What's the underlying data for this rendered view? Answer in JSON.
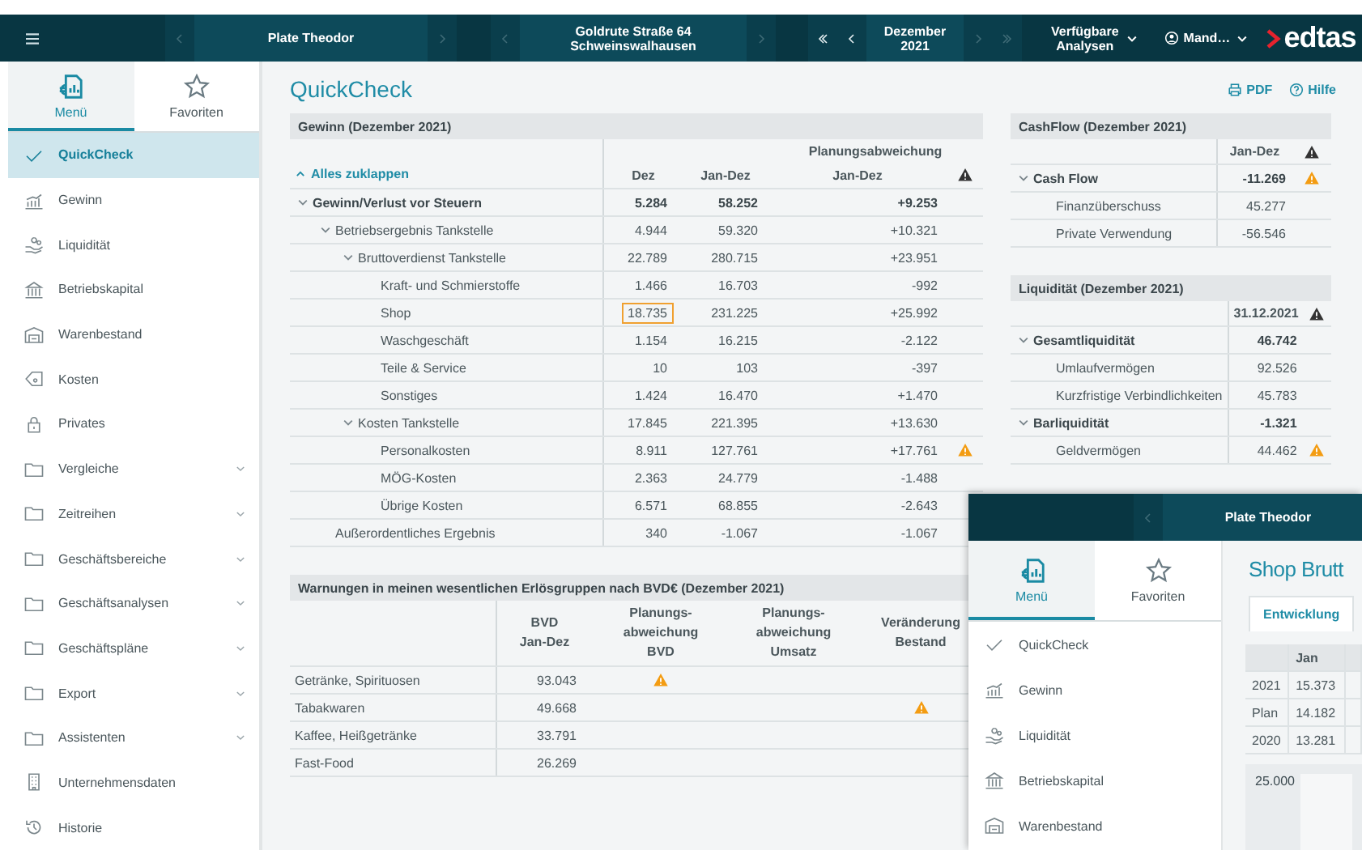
{
  "topbar": {
    "groups": [
      {
        "label": [
          "Plate Theodor"
        ],
        "before": [
          {
            "kind": "prev",
            "disabled": true
          }
        ],
        "after": [
          {
            "kind": "next",
            "disabled": true
          }
        ]
      },
      {
        "label": [
          "Goldrute Straße 64",
          "Schweinswalhausen"
        ],
        "before": [
          {
            "kind": "prev",
            "disabled": true
          }
        ],
        "after": [
          {
            "kind": "next",
            "disabled": true
          }
        ]
      },
      {
        "label": [
          "Dezember",
          "2021"
        ],
        "before": [
          {
            "kind": "first",
            "disabled": false
          },
          {
            "kind": "prev",
            "disabled": false
          }
        ],
        "after": [
          {
            "kind": "next",
            "disabled": true
          },
          {
            "kind": "last",
            "disabled": true
          }
        ]
      }
    ],
    "analyses": [
      "Verfügbare",
      "Analysen"
    ],
    "user": "Mand…",
    "logo": "edtas"
  },
  "menu_tabs": [
    {
      "label": "Menü",
      "selected": true
    },
    {
      "label": "Favoriten",
      "selected": false
    }
  ],
  "sidebar": [
    {
      "label": "QuickCheck",
      "kind": "page",
      "selected": true
    },
    {
      "label": "Gewinn",
      "kind": "page",
      "selected": false
    },
    {
      "label": "Liquidität",
      "kind": "page",
      "selected": false
    },
    {
      "label": "Betriebskapital",
      "kind": "page",
      "selected": false
    },
    {
      "label": "Warenbestand",
      "kind": "page",
      "selected": false
    },
    {
      "label": "Kosten",
      "kind": "page",
      "selected": false
    },
    {
      "label": "Privates",
      "kind": "page",
      "selected": false
    },
    {
      "label": "Vergleiche",
      "kind": "group",
      "selected": false
    },
    {
      "label": "Zeitreihen",
      "kind": "group",
      "selected": false
    },
    {
      "label": "Geschäftsbereiche",
      "kind": "group",
      "selected": false
    },
    {
      "label": "Geschäftsanalysen",
      "kind": "group",
      "selected": false
    },
    {
      "label": "Geschäftspläne",
      "kind": "group",
      "selected": false
    },
    {
      "label": "Export",
      "kind": "group",
      "selected": false
    },
    {
      "label": "Assistenten",
      "kind": "group",
      "selected": false
    },
    {
      "label": "Unternehmensdaten",
      "kind": "page",
      "selected": false
    },
    {
      "label": "Historie",
      "kind": "page",
      "selected": false
    }
  ],
  "title": "QuickCheck",
  "actions": [
    "PDF",
    "Hilfe"
  ],
  "gewinn": {
    "title": "Gewinn (Dezember 2021)",
    "collapse_all": "Alles zuklappen",
    "group_header": "Planungsabweichung",
    "columns": [
      "Dez",
      "Jan-Dez",
      "Jan-Dez"
    ],
    "rows": [
      {
        "label": "Gewinn/Verlust vor Steuern",
        "dez": "5.284",
        "jan_dez": "58.252",
        "deviation": "+9.253",
        "warning": false,
        "selected": false,
        "expanded": true,
        "children": [
          {
            "label": "Betriebsergebnis Tankstelle",
            "dez": "4.944",
            "jan_dez": "59.320",
            "deviation": "+10.321",
            "warning": false,
            "selected": false,
            "expanded": true,
            "children": [
              {
                "label": "Bruttoverdienst Tankstelle",
                "dez": "22.789",
                "jan_dez": "280.715",
                "deviation": "+23.951",
                "warning": false,
                "selected": false,
                "expanded": true,
                "children": [
                  {
                    "label": "Kraft- und Schmierstoffe",
                    "dez": "1.466",
                    "jan_dez": "16.703",
                    "deviation": "-992",
                    "warning": false,
                    "selected": false
                  },
                  {
                    "label": "Shop",
                    "dez": "18.735",
                    "jan_dez": "231.225",
                    "deviation": "+25.992",
                    "warning": false,
                    "selected": true
                  },
                  {
                    "label": "Waschgeschäft",
                    "dez": "1.154",
                    "jan_dez": "16.215",
                    "deviation": "-2.122",
                    "warning": false,
                    "selected": false
                  },
                  {
                    "label": "Teile & Service",
                    "dez": "10",
                    "jan_dez": "103",
                    "deviation": "-397",
                    "warning": false,
                    "selected": false
                  },
                  {
                    "label": "Sonstiges",
                    "dez": "1.424",
                    "jan_dez": "16.470",
                    "deviation": "+1.470",
                    "warning": false,
                    "selected": false
                  }
                ]
              },
              {
                "label": "Kosten Tankstelle",
                "dez": "17.845",
                "jan_dez": "221.395",
                "deviation": "+13.630",
                "warning": false,
                "selected": false,
                "expanded": true,
                "children": [
                  {
                    "label": "Personalkosten",
                    "dez": "8.911",
                    "jan_dez": "127.761",
                    "deviation": "+17.761",
                    "warning": true,
                    "selected": false
                  },
                  {
                    "label": "MÖG-Kosten",
                    "dez": "2.363",
                    "jan_dez": "24.779",
                    "deviation": "-1.488",
                    "warning": false,
                    "selected": false
                  },
                  {
                    "label": "Übrige Kosten",
                    "dez": "6.571",
                    "jan_dez": "68.855",
                    "deviation": "-2.643",
                    "warning": false,
                    "selected": false
                  }
                ]
              }
            ]
          },
          {
            "label": "Außerordentliches Ergebnis",
            "dez": "340",
            "jan_dez": "-1.067",
            "deviation": "-1.067",
            "warning": false,
            "selected": false
          }
        ]
      }
    ]
  },
  "warnungen": {
    "title": "Warnungen in meinen wesentlichen Erlösgruppen nach BVD€ (Dezember 2021)",
    "columns": [
      "BVD\nJan-Dez",
      "Planungs-\nabweichung\nBVD",
      "Planungs-\nabweichung\nUmsatz",
      "Veränderung\nBestand"
    ],
    "rows": [
      {
        "label": "Getränke, Spirituosen",
        "value": "93.043",
        "warn_bvd": true,
        "warn_umsatz": false,
        "warn_bestand": false
      },
      {
        "label": "Tabakwaren",
        "value": "49.668",
        "warn_bvd": false,
        "warn_umsatz": false,
        "warn_bestand": true
      },
      {
        "label": "Kaffee, Heißgetränke",
        "value": "33.791",
        "warn_bvd": false,
        "warn_umsatz": false,
        "warn_bestand": false
      },
      {
        "label": "Fast-Food",
        "value": "26.269",
        "warn_bvd": false,
        "warn_umsatz": false,
        "warn_bestand": false
      }
    ]
  },
  "cashflow": {
    "title": "CashFlow (Dezember 2021)",
    "column": "Jan-Dez",
    "rows": [
      {
        "label": "Cash Flow",
        "value": "-11.269",
        "warning": true,
        "expanded": true,
        "children": [
          {
            "label": "Finanzüberschuss",
            "value": "45.277",
            "warning": false
          },
          {
            "label": "Private Verwendung",
            "value": "-56.546",
            "warning": false
          }
        ]
      }
    ]
  },
  "liquiditaet": {
    "title": "Liquidität (Dezember 2021)",
    "column": "31.12.2021",
    "rows": [
      {
        "label": "Gesamtliquidität",
        "value": "46.742",
        "warning": false,
        "expanded": true,
        "children": [
          {
            "label": "Umlaufvermögen",
            "value": "92.526",
            "warning": false
          },
          {
            "label": "Kurzfristige Verbindlichkeiten",
            "value": "45.783",
            "warning": false
          }
        ]
      },
      {
        "label": "Barliquidität",
        "value": "-1.321",
        "warning": false,
        "expanded": true,
        "children": [
          {
            "label": "Geldvermögen",
            "value": "44.462",
            "warning": true
          }
        ]
      }
    ]
  },
  "overlay": {
    "location": "Plate Theodor",
    "before": [
      {
        "kind": "prev",
        "disabled": true
      }
    ],
    "menu_tabs": [
      {
        "label": "Menü",
        "selected": true
      },
      {
        "label": "Favoriten",
        "selected": false
      }
    ],
    "sidebar": [
      {
        "label": "QuickCheck",
        "selected": false
      },
      {
        "label": "Gewinn",
        "selected": false
      },
      {
        "label": "Liquidität",
        "selected": false
      },
      {
        "label": "Betriebskapital",
        "selected": false
      },
      {
        "label": "Warenbestand",
        "selected": false
      }
    ],
    "title": "Shop Brutt",
    "tabs": [
      {
        "label": "Entwicklung",
        "selected": true
      }
    ],
    "table": {
      "column": "Jan",
      "rows": [
        {
          "label": "2021",
          "value": "15.373"
        },
        {
          "label": "Plan",
          "value": "14.182"
        },
        {
          "label": "2020",
          "value": "13.281"
        }
      ]
    },
    "chart_label": "25.000"
  }
}
